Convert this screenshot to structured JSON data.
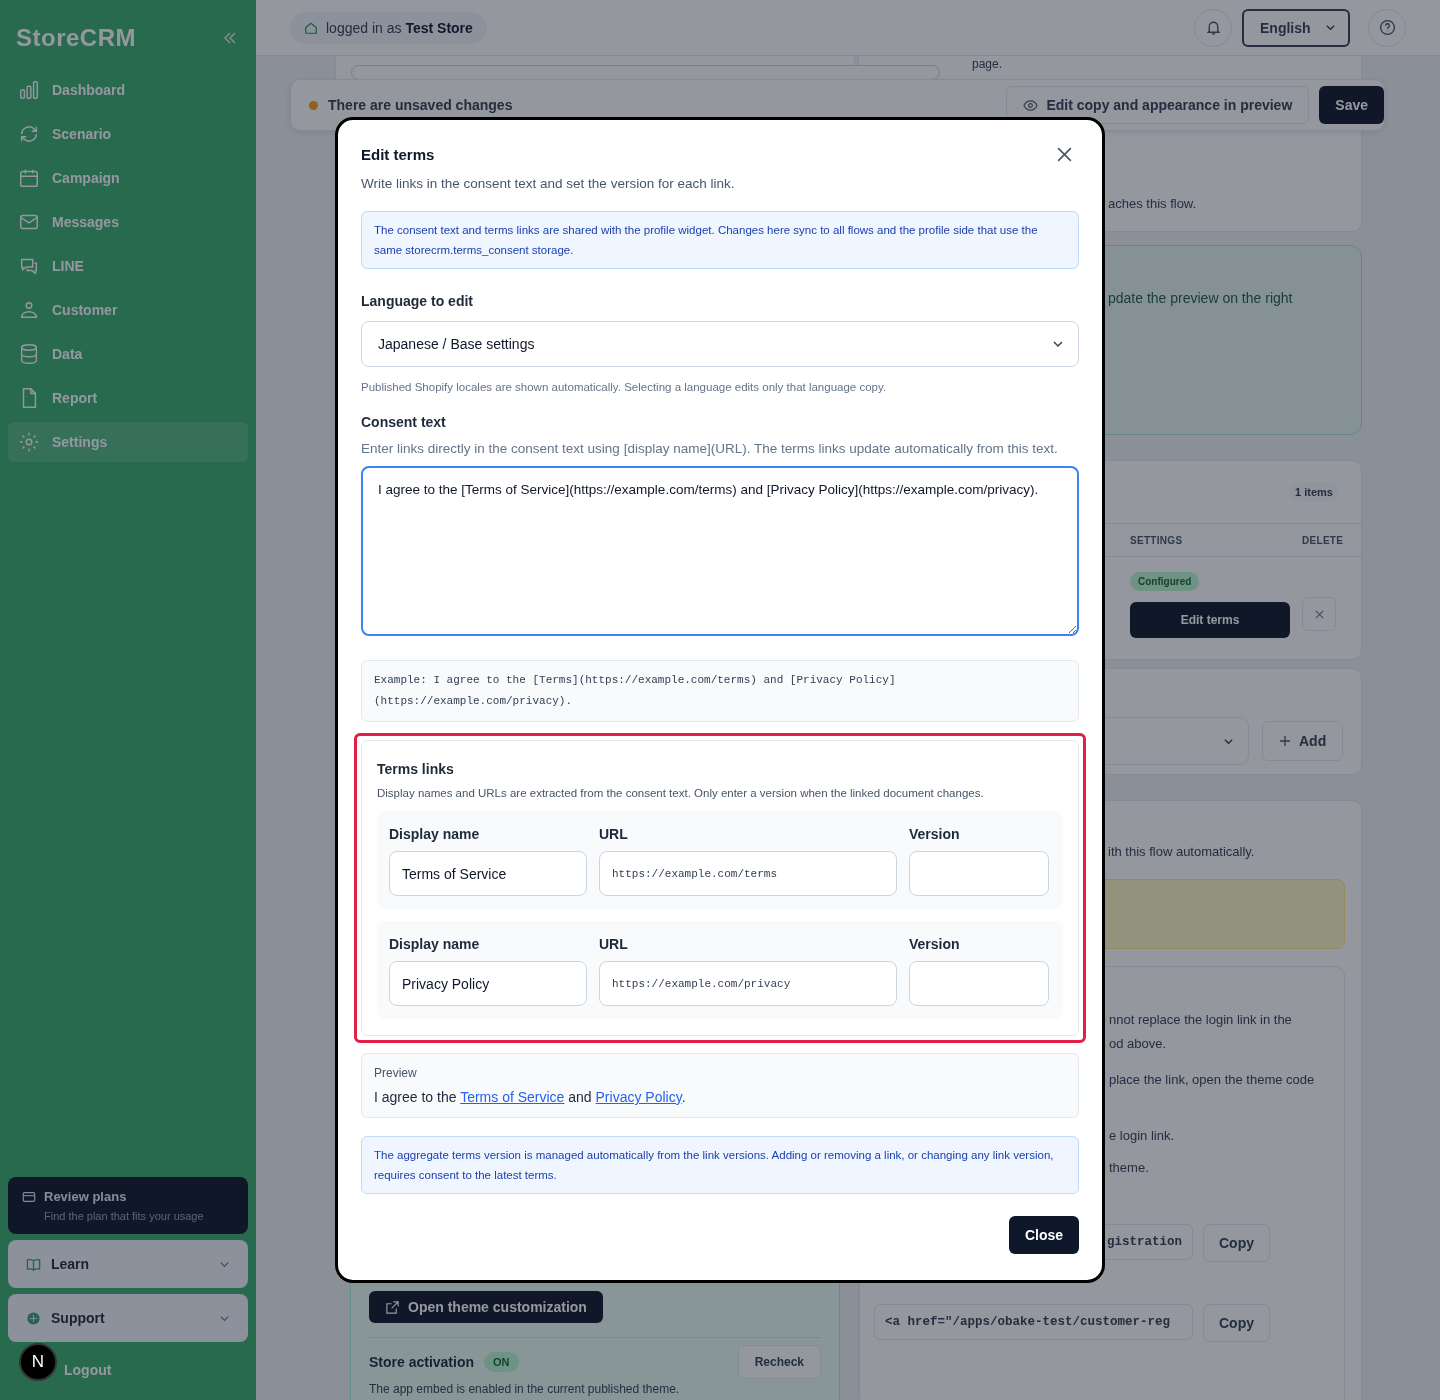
{
  "sidebar": {
    "logo": "StoreCRM",
    "items": [
      {
        "label": "Dashboard",
        "selected": false
      },
      {
        "label": "Scenario",
        "selected": false
      },
      {
        "label": "Campaign",
        "selected": false
      },
      {
        "label": "Messages",
        "selected": false
      },
      {
        "label": "LINE",
        "selected": false
      },
      {
        "label": "Customer",
        "selected": false
      },
      {
        "label": "Data",
        "selected": false
      },
      {
        "label": "Report",
        "selected": false
      },
      {
        "label": "Settings",
        "selected": true
      }
    ],
    "promo": {
      "title": "Review plans",
      "subtitle": "Find the plan that fits your usage"
    },
    "menus": [
      {
        "label": "Learn",
        "expanded": false
      },
      {
        "label": "Support",
        "expanded": false
      }
    ],
    "logout": "Logout",
    "dev_badge": "N"
  },
  "header": {
    "login_prefix": "logged in as",
    "store": "Test Store",
    "language": "English"
  },
  "unsaved_bar": {
    "message": "There are unsaved changes",
    "preview_button": "Edit copy and appearance in preview",
    "save_button": "Save"
  },
  "left_panel": {
    "theme_button": "Open theme customization",
    "activation_label": "Store activation",
    "activation_status": "ON",
    "recheck_button": "Recheck",
    "activation_note": "The app embed is enabled in the current published theme."
  },
  "right_panel": {
    "top_note": "page.",
    "flow_note": "aches this flow.",
    "preview_hint": "pdate the preview on the right",
    "count": "1 items",
    "columns": [
      "SETTINGS",
      "DELETE"
    ],
    "status": "Configured",
    "edit_button": "Edit terms",
    "add_button": "Add",
    "auto_note": "ith this flow automatically.",
    "instructions": [
      "nnot replace the login link in the",
      "od above.",
      "place the link, open the theme code",
      "e login link.",
      "theme."
    ],
    "code_fields": [
      {
        "value": "gistration",
        "copy": "Copy"
      },
      {
        "value": "<a href=\"/apps/obake-test/customer-reg",
        "copy": "Copy"
      }
    ]
  },
  "modal": {
    "title": "Edit terms",
    "subtitle": "Write links in the consent text and set the version for each link.",
    "sync_notice": "The consent text and terms links are shared with the profile widget. Changes here sync to all flows and the profile side that use the same storecrm.terms_consent storage.",
    "language_label": "Language to edit",
    "language_value": "Japanese / Base settings",
    "language_help": "Published Shopify locales are shown automatically. Selecting a language edits only that language copy.",
    "consent_label": "Consent text",
    "consent_help": "Enter links directly in the consent text using [display name](URL). The terms links update automatically from this text.",
    "consent_value": "I agree to the [Terms of Service](https://example.com/terms) and [Privacy Policy](https://example.com/privacy).",
    "example": "Example: I agree to the [Terms](https://example.com/terms) and [Privacy Policy](https://example.com/privacy).",
    "terms_title": "Terms links",
    "terms_description": "Display names and URLs are extracted from the consent text. Only enter a version when the linked document changes.",
    "links": [
      {
        "name_label": "Display name",
        "name": "Terms of Service",
        "url_label": "URL",
        "url": "https://example.com/terms",
        "version_label": "Version"
      },
      {
        "name_label": "Display name",
        "name": "Privacy Policy",
        "url_label": "URL",
        "url": "https://example.com/privacy",
        "version_label": "Version"
      }
    ],
    "preview_label": "Preview",
    "preview": [
      {
        "kind": "text",
        "text": "I agree to the "
      },
      {
        "kind": "link",
        "text": "Terms of Service"
      },
      {
        "kind": "text",
        "text": " and "
      },
      {
        "kind": "link",
        "text": "Privacy Policy"
      },
      {
        "kind": "text",
        "text": "."
      }
    ],
    "version_notice": "The aggregate terms version is managed automatically from the link versions. Adding or removing a link, or changing any link version, requires consent to the latest terms.",
    "close_button": "Close"
  }
}
